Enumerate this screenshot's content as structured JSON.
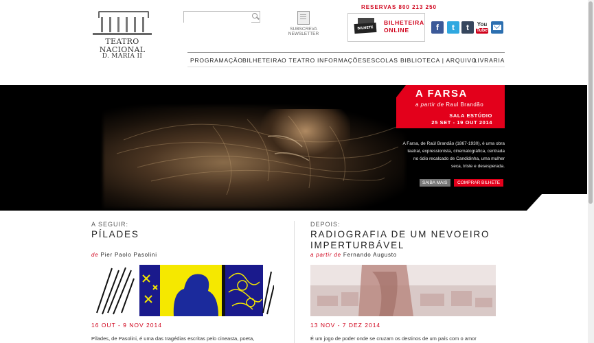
{
  "header": {
    "logo": {
      "line1": "TEATRO",
      "line2": "NACIONAL",
      "line3": "D. MARIA II"
    },
    "search": {
      "placeholder": ""
    },
    "newsletter": {
      "line1": "SUBSCREVA",
      "line2": "NEWSLETTER"
    },
    "reservas": "RESERVAS 800 213 250",
    "bilhete_online": {
      "line1": "BILHETEIRA",
      "line2": "ONLINE",
      "ticket_text": "BILHETE"
    },
    "social": {
      "facebook": "f",
      "twitter": "t",
      "tumblr": "t",
      "youtube_top": "You",
      "youtube_bottom": "Tube"
    }
  },
  "nav": {
    "items": [
      "PROGRAMAÇÃO",
      "BILHETEIRA",
      "O TEATRO",
      "INFORMAÇÕES",
      "ESCOLAS",
      "BIBLIOTECA | ARQUIVO",
      "LIVRARIA"
    ]
  },
  "hero": {
    "title": "A FARSA",
    "by_prefix": "a partir de",
    "author": "Raul Brandão",
    "venue": "SALA ESTÚDIO",
    "dates": "25 SET - 19 OUT 2014",
    "description": "A Farsa, de Raúl Brandão (1867-1930), é uma obra teatral, expressionista, cinematográfica, centrada no ódio recalcado de Candidinha, uma mulher seca, triste e desesperada.",
    "saiba_mais": "SAIBA MAIS",
    "comprar": "COMPRAR BILHETE"
  },
  "next": {
    "label": "A SEGUIR:",
    "title": "PÍLADES",
    "by_prefix": "de",
    "author": "Pier Paolo Pasolini",
    "dates": "16 OUT - 9 NOV 2014",
    "text": "Pílades, de Pasolini, é uma das tragédias escritas pelo cineasta, poeta,"
  },
  "after": {
    "label": "DEPOIS:",
    "title_line1": "RADIOGRAFIA DE UM NEVOEIRO",
    "title_line2": "IMPERTURBÁVEL",
    "by_prefix": "a partir de",
    "author": "Fernando Augusto",
    "dates": "13 NOV - 7 DEZ 2014",
    "text": "É um jogo de poder onde se cruzam os destinos de um país com o amor"
  },
  "colors": {
    "accent": "#e3001b",
    "nav_text": "#222222",
    "hero_bg": "#000000"
  }
}
